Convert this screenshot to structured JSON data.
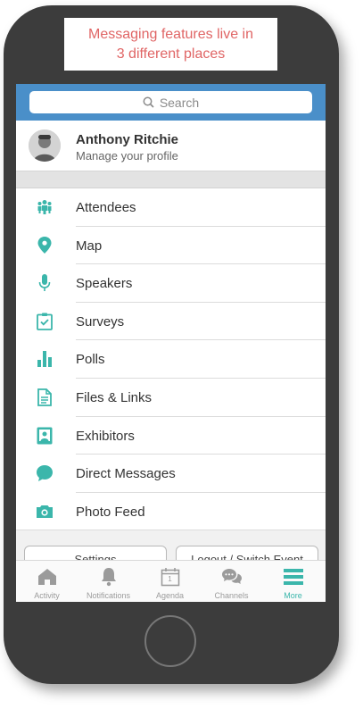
{
  "callout": {
    "text": "Messaging features live in\n3 different places"
  },
  "colors": {
    "accent": "#3bb6ab",
    "header": "#4a8fc9",
    "callout_text": "#e06565"
  },
  "search": {
    "placeholder": "Search",
    "icon": "search-icon"
  },
  "profile": {
    "name": "Anthony Ritchie",
    "subtitle": "Manage your profile"
  },
  "menu": {
    "items": [
      {
        "label": "Attendees",
        "icon": "attendees-icon"
      },
      {
        "label": "Map",
        "icon": "map-pin-icon"
      },
      {
        "label": "Speakers",
        "icon": "microphone-icon"
      },
      {
        "label": "Surveys",
        "icon": "clipboard-check-icon"
      },
      {
        "label": "Polls",
        "icon": "bar-chart-icon"
      },
      {
        "label": "Files & Links",
        "icon": "document-icon"
      },
      {
        "label": "Exhibitors",
        "icon": "badge-icon"
      },
      {
        "label": "Direct Messages",
        "icon": "chat-bubble-icon"
      },
      {
        "label": "Photo Feed",
        "icon": "camera-icon"
      }
    ]
  },
  "bottom_buttons": {
    "settings": "Settings",
    "logout": "Logout / Switch Event"
  },
  "tabs": {
    "activity": "Activity",
    "notifications": "Notifications",
    "agenda": "Agenda",
    "agenda_day": "1",
    "channels": "Channels",
    "more": "More",
    "active": "More"
  }
}
